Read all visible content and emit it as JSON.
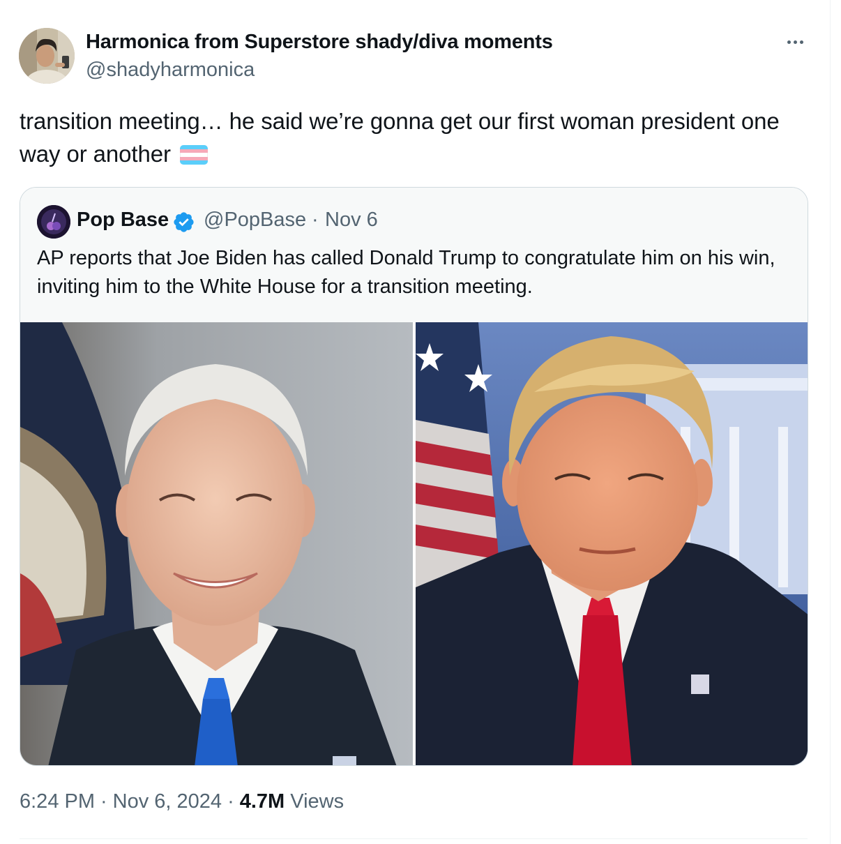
{
  "tweet": {
    "author_name": "Harmonica from Superstore shady/diva moments",
    "author_handle": "@shadyharmonica",
    "text": "transition meeting… he said we’re gonna get our first woman president one way or another",
    "emoji": "transgender-flag",
    "more_icon": "ellipsis-icon",
    "time": "6:24 PM",
    "date": "Nov 6, 2024",
    "separator": "·",
    "views_count": "4.7M",
    "views_label": "Views"
  },
  "quote": {
    "author_name": "Pop Base",
    "verified_icon": "verified-badge-icon",
    "author_handle": "@PopBase",
    "separator": "·",
    "date": "Nov 6",
    "text": "AP reports that Joe Biden has called Donald Trump to congratulate him on his win, inviting him to the White House for a transition meeting.",
    "images": [
      "biden-portrait-photo",
      "trump-portrait-photo"
    ]
  },
  "colors": {
    "text_primary": "#0f1419",
    "text_secondary": "#536471",
    "border": "#cfd9de",
    "verified_blue": "#1d9bf0",
    "flag_blue": "#5bcefa",
    "flag_pink": "#f5a9b8"
  }
}
